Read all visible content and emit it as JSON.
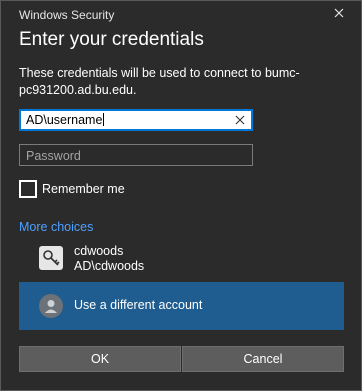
{
  "window": {
    "title": "Windows Security"
  },
  "dialog": {
    "heading": "Enter your credentials",
    "description": "These credentials will be used to connect to bumc-pc931200.ad.bu.edu."
  },
  "fields": {
    "username_value": "AD\\username",
    "password_placeholder": "Password"
  },
  "remember": {
    "label": "Remember me",
    "checked": false
  },
  "more_choices": "More choices",
  "accounts": [
    {
      "name": "cdwoods",
      "domain_user": "AD\\cdwoods",
      "icon": "key-icon"
    }
  ],
  "alt_account": {
    "label": "Use a different account",
    "icon": "person-icon"
  },
  "buttons": {
    "ok": "OK",
    "cancel": "Cancel"
  },
  "colors": {
    "background": "#2b2b2b",
    "accent": "#0078d7",
    "link": "#4ea0ff",
    "selected": "#1f5c8f"
  }
}
